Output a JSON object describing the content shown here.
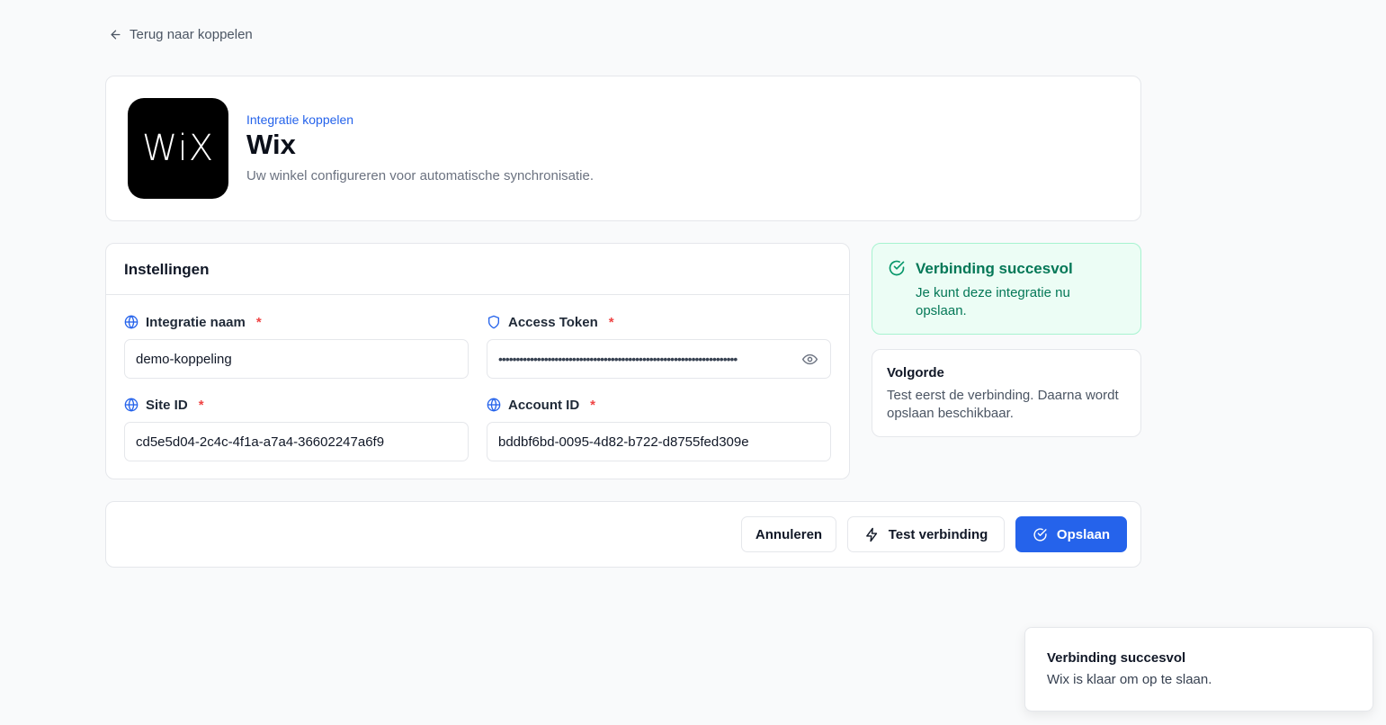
{
  "back_link": {
    "label": "Terug naar koppelen",
    "icon": "arrow-left-icon"
  },
  "header": {
    "logo_text": "WiX",
    "eyebrow": "Integratie koppelen",
    "title": "Wix",
    "subtitle": "Uw winkel configureren voor automatische synchronisatie."
  },
  "settings": {
    "title": "Instellingen",
    "fields": {
      "name": {
        "label": "Integratie naam",
        "required": "*",
        "value": "demo-koppeling",
        "icon": "globe-icon"
      },
      "token": {
        "label": "Access Token",
        "required": "*",
        "value": "••••••••••••••••••••••••••••••••••••••••••••••••••••••••••••••••••••",
        "icon": "shield-icon"
      },
      "site": {
        "label": "Site ID",
        "required": "*",
        "value": "cd5e5d04-2c4c-4f1a-a7a4-36602247a6f9",
        "icon": "globe-icon"
      },
      "account": {
        "label": "Account ID",
        "required": "*",
        "value": "bddbf6bd-0095-4d82-b722-d8755fed309e",
        "icon": "globe-icon"
      }
    }
  },
  "status": {
    "title": "Verbinding succesvol",
    "text": "Je kunt deze integratie nu opslaan.",
    "color": "#047857"
  },
  "order": {
    "title": "Volgorde",
    "text": "Test eerst de verbinding. Daarna wordt opslaan beschikbaar."
  },
  "actions": {
    "cancel": "Annuleren",
    "test": "Test verbinding",
    "save": "Opslaan",
    "accent": "#2563eb"
  },
  "toast": {
    "title": "Verbinding succesvol",
    "text": "Wix is klaar om op te slaan."
  }
}
